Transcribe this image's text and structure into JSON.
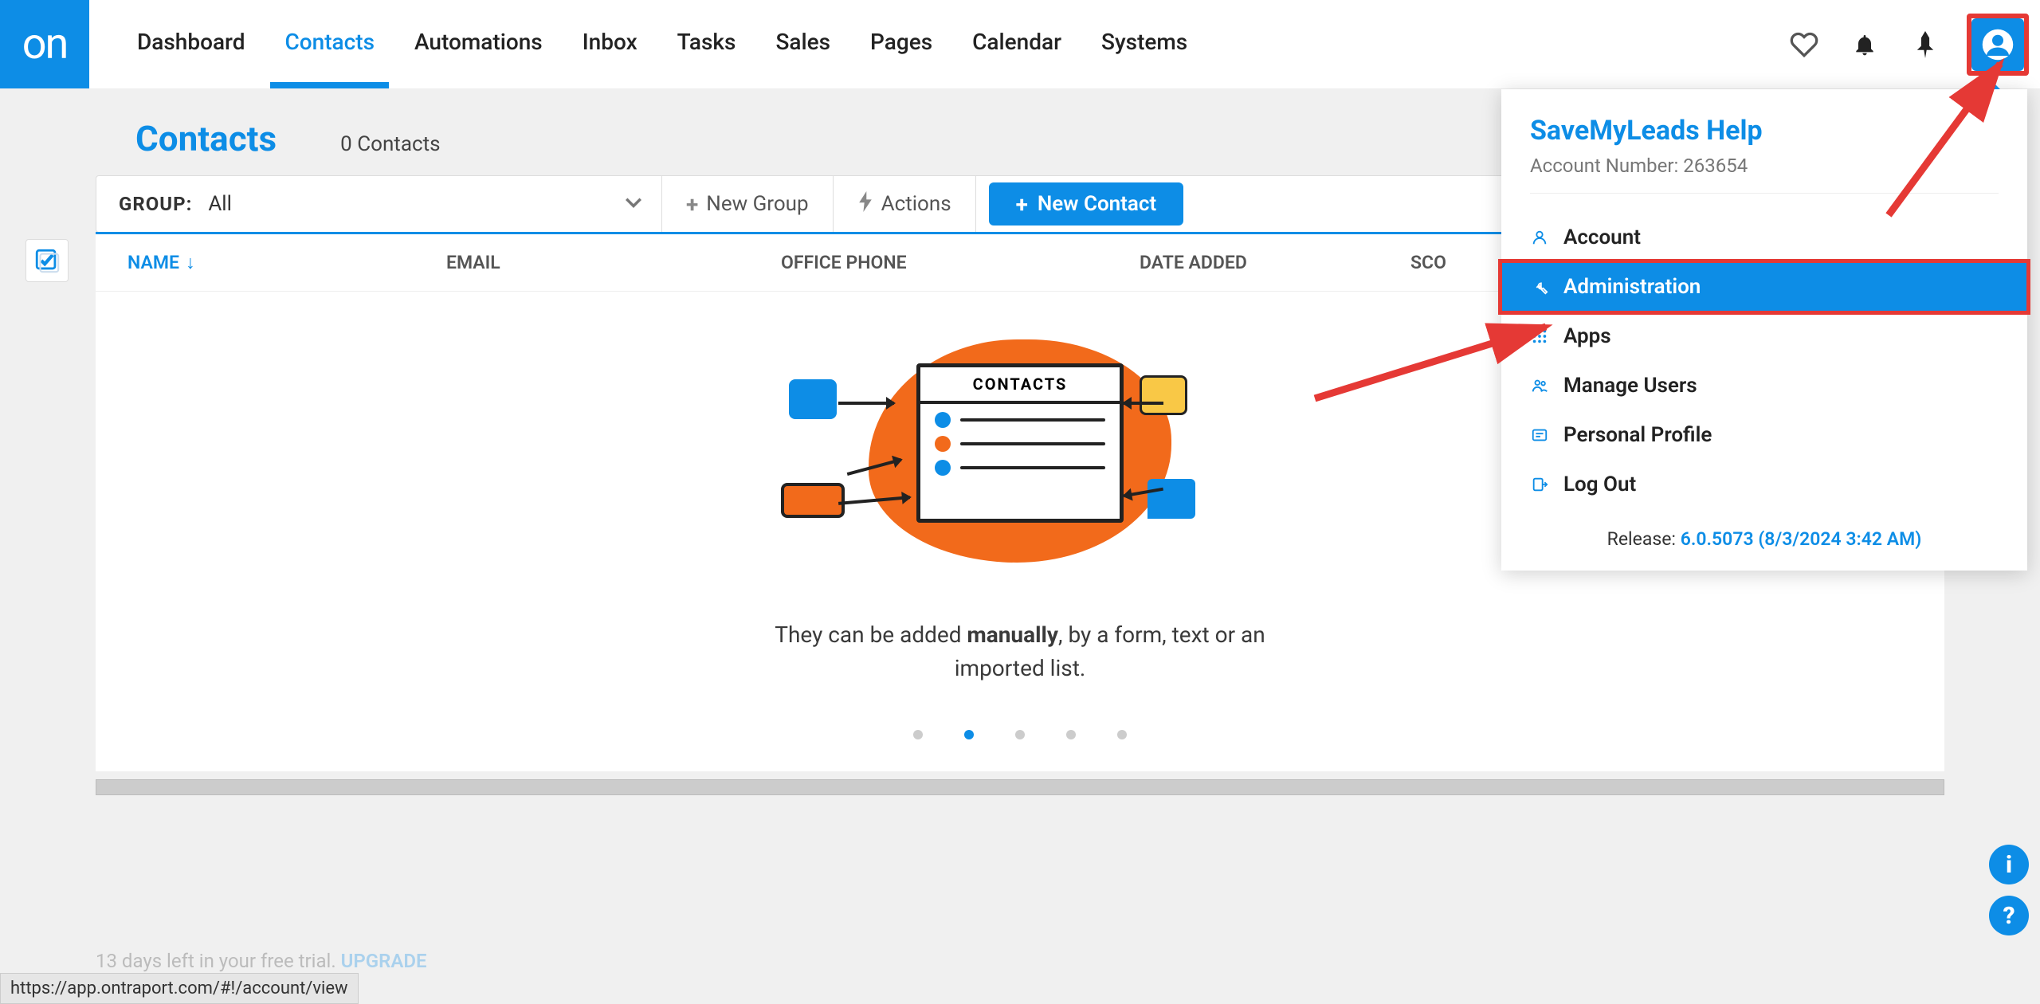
{
  "nav": {
    "items": [
      "Dashboard",
      "Contacts",
      "Automations",
      "Inbox",
      "Tasks",
      "Sales",
      "Pages",
      "Calendar",
      "Systems"
    ],
    "active_index": 1
  },
  "page": {
    "title": "Contacts",
    "count_label": "0 Contacts"
  },
  "toolbar": {
    "group_label": "GROUP:",
    "group_value": "All",
    "new_group": "New Group",
    "actions": "Actions",
    "new_contact": "New Contact"
  },
  "table": {
    "headers": {
      "name": "NAME",
      "email": "EMAIL",
      "phone": "OFFICE PHONE",
      "date": "DATE ADDED",
      "score": "SCO"
    }
  },
  "empty": {
    "card_title": "CONTACTS",
    "text_before": "They can be added ",
    "text_bold": "manually",
    "text_after": ", by a form, text or an imported list."
  },
  "dropdown": {
    "title": "SaveMyLeads Help",
    "account_number": "Account Number: 263654",
    "items": [
      {
        "label": "Account",
        "icon": "user"
      },
      {
        "label": "Administration",
        "icon": "wrench",
        "highlight": true
      },
      {
        "label": "Apps",
        "icon": "grid"
      },
      {
        "label": "Manage Users",
        "icon": "users"
      },
      {
        "label": "Personal Profile",
        "icon": "id"
      },
      {
        "label": "Log Out",
        "icon": "logout"
      }
    ],
    "release_prefix": "Release: ",
    "release_value": "6.0.5073 (8/3/2024 3:42 AM)"
  },
  "trial": {
    "text": "13 days left in your free trial. ",
    "link": "UPGRADE"
  },
  "status_url": "https://app.ontraport.com/#!/account/view"
}
